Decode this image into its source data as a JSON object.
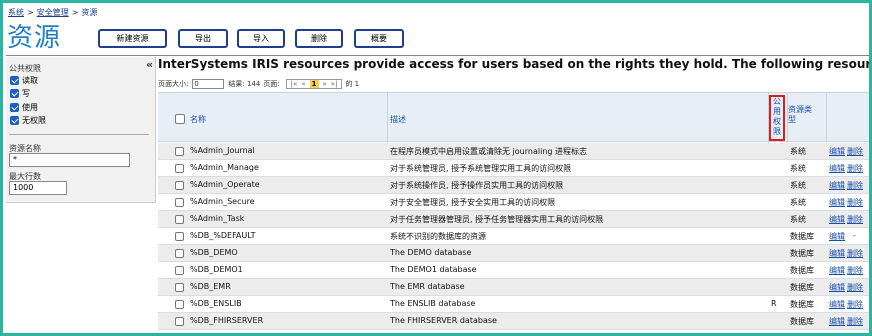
{
  "breadcrumb": [
    "系统",
    "安全管理",
    "资源"
  ],
  "page_title": "资源",
  "toolbar": {
    "new": "新建资源",
    "export": "导出",
    "import": "导入",
    "delete": "删除",
    "overview": "概要"
  },
  "sidebar": {
    "collapse_glyph": "«",
    "section_title": "公共权限",
    "checkboxes": [
      "读取",
      "写",
      "使用",
      "无权限"
    ],
    "name_label": "资源名称",
    "name_value": "*",
    "maxrows_label": "最大行数",
    "maxrows_value": "1000"
  },
  "description": "InterSystems IRIS resources provide access for users based on the rights they hold. The following resources are currently available",
  "pager": {
    "page_size_label": "页面大小:",
    "page_size_value": "0",
    "results_label": "结果: 144",
    "page_label": "页面:",
    "nav_first": "|«",
    "nav_prev": "«",
    "current_page": "1",
    "nav_next": "»",
    "nav_last": "»|",
    "of_label": "的 1"
  },
  "table": {
    "headers": {
      "name": "名称",
      "description": "描述",
      "public": "公\n用\n权\n限",
      "type": "资源类\n型"
    },
    "edit_label": "编辑",
    "delete_label": "删除",
    "rows": [
      {
        "name": "%Admin_Journal",
        "desc": "在程序员模式中启用设置或清除无 journaling 进程标志",
        "pub": "",
        "type": "系统",
        "del": "删除"
      },
      {
        "name": "%Admin_Manage",
        "desc": "对于系统管理员, 授予系统管理实用工具的访问权限",
        "pub": "",
        "type": "系统",
        "del": "删除"
      },
      {
        "name": "%Admin_Operate",
        "desc": "对于系统操作员, 授予操作员实用工具的访问权限",
        "pub": "",
        "type": "系统",
        "del": "删除"
      },
      {
        "name": "%Admin_Secure",
        "desc": "对于安全管理员, 授予安全实用工具的访问权限",
        "pub": "",
        "type": "系统",
        "del": "删除"
      },
      {
        "name": "%Admin_Task",
        "desc": "对于任务管理器管理员, 授予任务管理器实用工具的访问权限",
        "pub": "",
        "type": "系统",
        "del": "删除"
      },
      {
        "name": "%DB_%DEFAULT",
        "desc": "系统不识别的数据库的资源",
        "pub": "",
        "type": "数据库",
        "del": "-"
      },
      {
        "name": "%DB_DEMO",
        "desc": "The DEMO database",
        "pub": "",
        "type": "数据库",
        "del": "删除"
      },
      {
        "name": "%DB_DEMO1",
        "desc": "The DEMO1 database",
        "pub": "",
        "type": "数据库",
        "del": "删除"
      },
      {
        "name": "%DB_EMR",
        "desc": "The EMR database",
        "pub": "",
        "type": "数据库",
        "del": "删除"
      },
      {
        "name": "%DB_ENSLIB",
        "desc": "The ENSLIB database",
        "pub": "R",
        "type": "数据库",
        "del": "删除"
      },
      {
        "name": "%DB_FHIRSERVER",
        "desc": "The FHIRSERVER database",
        "pub": "",
        "type": "数据库",
        "del": "删除"
      }
    ]
  },
  "colors": {
    "frame": "#2bb5a0",
    "title": "#1e7fc6",
    "link": "#1a4ea8",
    "highlight_box": "#e21b1b",
    "current_page_bg": "#f7d14b"
  }
}
